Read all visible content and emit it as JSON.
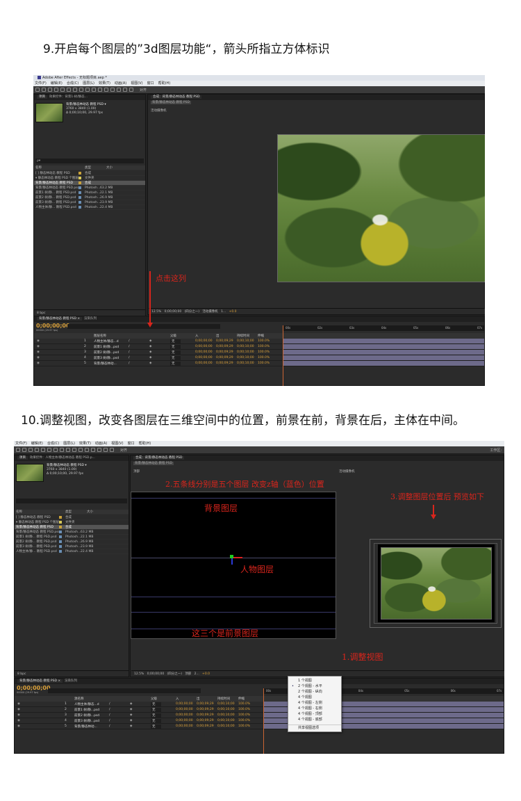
{
  "step9": {
    "heading": "9.开启每个图层的”3d图层功能“，箭头所指立方体标识",
    "window_title": "Adobe After Effects - 无标题项目.aep *",
    "menus": [
      "文件(F)",
      "编辑(E)",
      "合成(C)",
      "图层(L)",
      "效果(T)",
      "动画(A)",
      "视图(V)",
      "窗口",
      "帮助(H)"
    ],
    "toolbar_label": "对齐",
    "project_tab": "项目",
    "effects_tab": "效果控件：背景1·树/静态...",
    "comp_name": "背景/静态林动态 教程 PSD ▾",
    "comp_dims": "3760 x 3840 (1.00)",
    "comp_duration": "Δ 0;00;10;00, 29.97 fps",
    "search_placeholder": "ρ▾",
    "project_headers": [
      "名称",
      "类型",
      "大小"
    ],
    "project_rows": [
      {
        "name": "[ ] 静态林动态 教程 PSD",
        "type": "合成",
        "size": "",
        "color": "#c9a23a"
      },
      {
        "name": "▾ 静态林动态 教程 PSD 个图层",
        "type": "文件夹",
        "size": "",
        "color": "#d8c95a"
      },
      {
        "name": "背景/静态林动态 教程 PSD",
        "type": "合成",
        "size": "",
        "color": "#c9a23a"
      },
      {
        "name": "背景/静态林动态 教程 PSD.psd",
        "type": "Photosh...",
        "size": "63.2 MB",
        "color": "#6a8fb5"
      },
      {
        "name": "前景1 树/静... 教程 PSD.psd",
        "type": "Photosh...",
        "size": "22.1 MB",
        "color": "#6a8fb5"
      },
      {
        "name": "前景2 树/静... 教程 PSD.psd",
        "type": "Photosh...",
        "size": "26.9 MB",
        "color": "#6a8fb5"
      },
      {
        "name": "前景3 树/静... 教程 PSD.psd",
        "type": "Photosh...",
        "size": "23.9 MB",
        "color": "#6a8fb5"
      },
      {
        "name": "人物主体/静... 教程 PSD.psd",
        "type": "Photosh...",
        "size": "22.4 MB",
        "color": "#6a8fb5"
      }
    ],
    "comp_tab": "合成：背景/静态林动态 教程 PSD",
    "comp_sub": "背景/静态林动态 教程 PSD",
    "view_label": "活动摄像机",
    "bpc": "8 bpc",
    "zoom": "12.5%",
    "timecode_small": "0;00;00;00",
    "resolution": "(四分之一)",
    "camera_select": "活动摄像机",
    "views_select": "1...",
    "exposure": "+0.0",
    "timeline_tab": "背景/静态林动态 教程 PSD ×",
    "render_tab": "渲染队列",
    "timecode": "0;00;00;00",
    "timecode_sub": "00000 (29.97 fps)",
    "timeline_headers": [
      "图层名称",
      "父级",
      "入",
      "出",
      "持续时间",
      "伸缩"
    ],
    "ruler_ticks": [
      "00s",
      "02s",
      "03s",
      "04s",
      "05s",
      "06s",
      "07s"
    ],
    "layers": [
      {
        "num": "1",
        "name": "人物主体/静态...d",
        "parent": "无",
        "in": "0;00;00;00",
        "out": "0;00;09;29",
        "dur": "0;00;10;00",
        "stretch": "100.0%"
      },
      {
        "num": "2",
        "name": "前景1 树/静...psd",
        "parent": "无",
        "in": "0;00;00;00",
        "out": "0;00;09;29",
        "dur": "0;00;10;00",
        "stretch": "100.0%"
      },
      {
        "num": "3",
        "name": "前景2 树/静...psd",
        "parent": "无",
        "in": "0;00;00;00",
        "out": "0;00;09;29",
        "dur": "0;00;10;00",
        "stretch": "100.0%"
      },
      {
        "num": "4",
        "name": "前景3 树/静...psd",
        "parent": "无",
        "in": "0;00;00;00",
        "out": "0;00;09;29",
        "dur": "0;00;10;00",
        "stretch": "100.0%"
      },
      {
        "num": "5",
        "name": "背景/静态林动...",
        "parent": "无",
        "in": "0;00;00;00",
        "out": "0;00;09;29",
        "dur": "0;00;10;00",
        "stretch": "100.0%"
      }
    ],
    "annotation": "点击这列"
  },
  "step10": {
    "heading": "10.调整视图，改变各图层在三维空间中的位置，前景在前，背景在后，主体在中间。",
    "menus": [
      "文件(F)",
      "编辑(E)",
      "合成(C)",
      "图层(L)",
      "效果(T)",
      "动画(A)",
      "视图(V)",
      "窗口",
      "帮助(H)"
    ],
    "toolbar_label": "对齐",
    "workspace": "工作区:",
    "project_tab": "项目",
    "effects_tab": "效果控件：人物主体/静态林动态 教程 PSD.p...",
    "comp_name": "背景/静态林动态 教程 PSD ▾",
    "comp_dims": "3760 x 3840 (1.00)",
    "comp_duration": "Δ 0;00;10;00, 29.97 fps",
    "project_headers": [
      "名称",
      "类型",
      "大小"
    ],
    "project_rows": [
      {
        "name": "[ ] 静态林动态 教程 PSD",
        "type": "合成",
        "size": "",
        "color": "#c9a23a"
      },
      {
        "name": "▾ 静态林动态 教程 PSD 个图层",
        "type": "文件夹",
        "size": "",
        "color": "#d8c95a"
      },
      {
        "name": "背景/静态林动态 教程 PSD",
        "type": "合成",
        "size": "",
        "color": "#c9a23a"
      },
      {
        "name": "背景/静态林动态 教程 PSD.psd",
        "type": "Photosh...",
        "size": "63.2 MB",
        "color": "#6a8fb5"
      },
      {
        "name": "前景1 树/静... 教程 PSD.psd",
        "type": "Photosh...",
        "size": "22.1 MB",
        "color": "#6a8fb5"
      },
      {
        "name": "前景2 树/静... 教程 PSD.psd",
        "type": "Photosh...",
        "size": "26.9 MB",
        "color": "#6a8fb5"
      },
      {
        "name": "前景3 树/静... 教程 PSD.psd",
        "type": "Photosh...",
        "size": "23.9 MB",
        "color": "#6a8fb5"
      },
      {
        "name": "人物主体/静... 教程 PSD.psd",
        "type": "Photosh...",
        "size": "22.4 MB",
        "color": "#6a8fb5"
      }
    ],
    "comp_tab": "合成：背景/静态林动态 教程 PSD",
    "comp_sub": "背景/静态林动态 教程 PSD",
    "left_view_label": "顶部",
    "right_view_label": "活动摄像机",
    "bpc": "8 bpc",
    "zoom": "12.5%",
    "timecode_small": "0;00;00;00",
    "resolution": "(四分之一)",
    "view_select": "顶部",
    "views_select": "2...",
    "exposure": "+0.0",
    "view_menu": [
      {
        "label": "1 个视图",
        "checked": false
      },
      {
        "label": "2 个视图 - 水平",
        "checked": true
      },
      {
        "label": "2 个视图 - 纵向",
        "checked": false
      },
      {
        "label": "4 个视图",
        "checked": false
      },
      {
        "label": "4 个视图 - 左侧",
        "checked": false
      },
      {
        "label": "4 个视图 - 右侧",
        "checked": false
      },
      {
        "label": "4 个视图 - 顶部",
        "checked": false
      },
      {
        "label": "4 个视图 - 底部",
        "checked": false
      },
      {
        "label": "共享视图选项",
        "checked": false
      }
    ],
    "timeline_tab": "背景/静态林动态 教程 PSD ×",
    "render_tab": "渲染队列",
    "timecode": "0;00;00;00",
    "timecode_sub": "00000 (29.97 fps)",
    "timeline_headers": [
      "源名称",
      "父级",
      "入",
      "出",
      "持续时间",
      "伸缩"
    ],
    "ruler_ticks": [
      "00s",
      "02s",
      "04s",
      "05s",
      "06s",
      "07s"
    ],
    "layers": [
      {
        "num": "1",
        "name": "人物主体/静态...d",
        "parent": "无",
        "in": "0;00;00;00",
        "out": "0;00;09;29",
        "dur": "0;00;10;00",
        "stretch": "100.0%"
      },
      {
        "num": "2",
        "name": "前景1 树/静...psd",
        "parent": "无",
        "in": "0;00;00;00",
        "out": "0;00;09;29",
        "dur": "0;00;10;00",
        "stretch": "100.0%"
      },
      {
        "num": "3",
        "name": "前景2 树/静...psd",
        "parent": "无",
        "in": "0;00;00;00",
        "out": "0;00;09;29",
        "dur": "0;00;10;00",
        "stretch": "100.0%"
      },
      {
        "num": "4",
        "name": "前景3 树/静...psd",
        "parent": "无",
        "in": "0;00;00;00",
        "out": "0;00;09;29",
        "dur": "0;00;10;00",
        "stretch": "100.0%"
      },
      {
        "num": "5",
        "name": "背景/静态林动...",
        "parent": "无",
        "in": "0;00;00;00",
        "out": "0;00;09;29",
        "dur": "0;00;10;00",
        "stretch": "100.0%"
      }
    ],
    "annotations": {
      "z_axis": "2.五条线分别是五个图层 改变z轴（蓝色）位置",
      "preview": "3.调整图层位置后 预览如下",
      "background": "背景图层",
      "subject": "人物图层",
      "foreground": "这三个是前景图层",
      "adjust_view": "1.调整视图"
    }
  },
  "colors": {
    "annotation_red": "#d9251c",
    "panel_bg": "#2b2b2b",
    "timeline_bar": "#6d6a8a"
  }
}
